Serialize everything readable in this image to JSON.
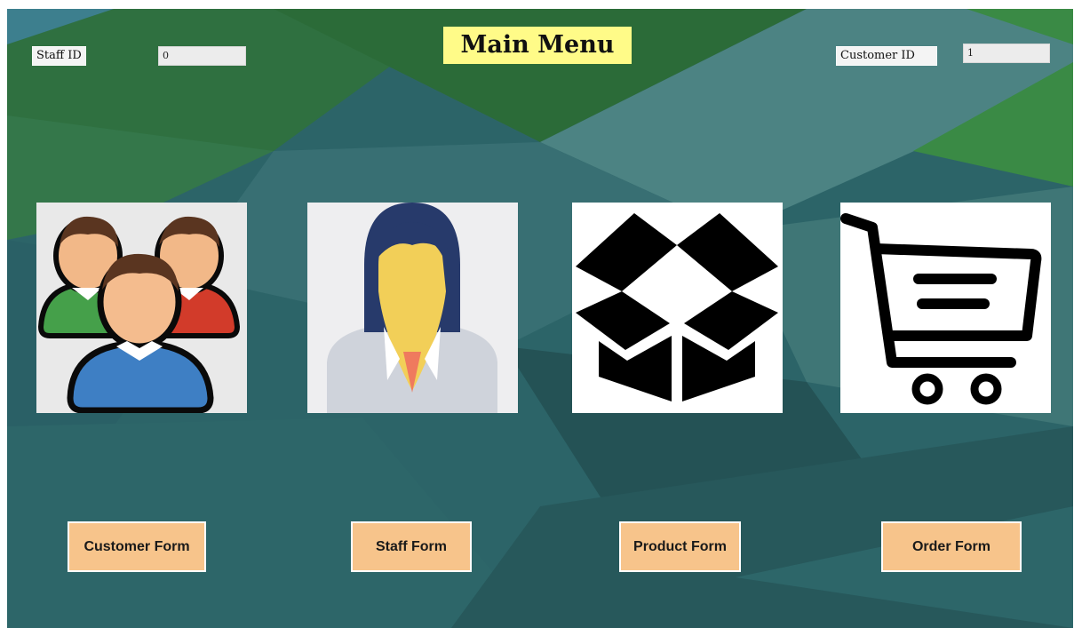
{
  "menu": {
    "title": "Main Menu",
    "staff_id": {
      "label": "Staff ID",
      "value": "0"
    },
    "customer_id": {
      "label": "Customer ID",
      "value": "1"
    }
  },
  "tiles": [
    {
      "icon": "customers-group-icon"
    },
    {
      "icon": "staff-woman-icon"
    },
    {
      "icon": "product-box-icon"
    },
    {
      "icon": "shopping-cart-icon"
    }
  ],
  "buttons": {
    "customer_form": "Customer Form",
    "staff_form": "Staff Form",
    "product_form": "Product Form",
    "order_form": "Order Form"
  },
  "colors": {
    "title_bg": "#fffb88",
    "button_bg": "#f7c48b",
    "background_dark": "#2a5e63",
    "background_green": "#2f7a3c"
  }
}
